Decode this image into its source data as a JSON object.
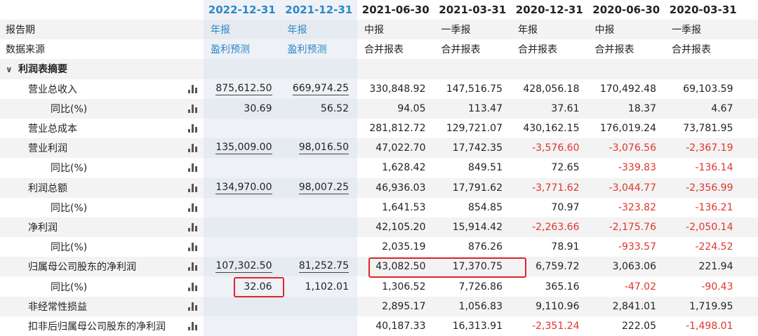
{
  "columns": [
    "2022-12-31",
    "2021-12-31",
    "2021-06-30",
    "2021-03-31",
    "2020-12-31",
    "2020-06-30",
    "2020-03-31"
  ],
  "report_period": {
    "label": "报告期",
    "values": [
      "年报",
      "年报",
      "中报",
      "一季报",
      "年报",
      "中报",
      "一季报"
    ]
  },
  "data_source": {
    "label": "数据来源",
    "values": [
      "盈利预测",
      "盈利预测",
      "合并报表",
      "合并报表",
      "合并报表",
      "合并报表",
      "合并报表"
    ]
  },
  "section": {
    "label": "利润表摘要"
  },
  "rows": [
    {
      "label": "营业总收入",
      "level": 1,
      "values": [
        "875,612.50",
        "669,974.25",
        "330,848.92",
        "147,516.75",
        "428,056.18",
        "170,492.48",
        "69,103.59"
      ]
    },
    {
      "label": "同比(%)",
      "level": 2,
      "values": [
        "30.69",
        "56.52",
        "94.05",
        "113.47",
        "37.61",
        "18.37",
        "4.67"
      ]
    },
    {
      "label": "营业总成本",
      "level": 1,
      "values": [
        "",
        "",
        "281,812.72",
        "129,721.07",
        "430,162.15",
        "176,019.24",
        "73,781.95"
      ]
    },
    {
      "label": "营业利润",
      "level": 1,
      "values": [
        "135,009.00",
        "98,016.50",
        "47,022.70",
        "17,742.35",
        "-3,576.60",
        "-3,076.56",
        "-2,367.19"
      ]
    },
    {
      "label": "同比(%)",
      "level": 2,
      "values": [
        "",
        "",
        "1,628.42",
        "849.51",
        "72.65",
        "-339.83",
        "-136.14"
      ]
    },
    {
      "label": "利润总额",
      "level": 1,
      "values": [
        "134,970.00",
        "98,007.25",
        "46,936.03",
        "17,791.62",
        "-3,771.62",
        "-3,044.77",
        "-2,356.99"
      ]
    },
    {
      "label": "同比(%)",
      "level": 2,
      "values": [
        "",
        "",
        "1,641.53",
        "854.85",
        "70.97",
        "-323.82",
        "-136.21"
      ]
    },
    {
      "label": "净利润",
      "level": 1,
      "values": [
        "",
        "",
        "42,105.20",
        "15,914.42",
        "-2,263.66",
        "-2,175.76",
        "-2,050.14"
      ]
    },
    {
      "label": "同比(%)",
      "level": 2,
      "values": [
        "",
        "",
        "2,035.19",
        "876.26",
        "78.91",
        "-933.57",
        "-224.52"
      ]
    },
    {
      "label": "归属母公司股东的净利润",
      "level": 1,
      "values": [
        "107,302.50",
        "81,252.75",
        "43,082.50",
        "17,370.75",
        "6,759.72",
        "3,063.06",
        "221.94"
      ]
    },
    {
      "label": "同比(%)",
      "level": 2,
      "values": [
        "32.06",
        "1,102.01",
        "1,306.52",
        "7,726.86",
        "365.16",
        "-47.02",
        "-90.43"
      ]
    },
    {
      "label": "非经常性损益",
      "level": 1,
      "values": [
        "",
        "",
        "2,895.17",
        "1,056.83",
        "9,110.96",
        "2,841.01",
        "1,719.95"
      ]
    },
    {
      "label": "扣非后归属母公司股东的净利润",
      "level": 1,
      "values": [
        "",
        "",
        "40,187.33",
        "16,313.91",
        "-2,351.24",
        "222.05",
        "-1,498.01"
      ]
    }
  ],
  "colors": {
    "forecast_header": "#2b87c8",
    "negative": "#e0352b",
    "highlight_box": "#e0242b",
    "alt_row": "#f3f3f3"
  },
  "icons": {
    "row_chart": "bar-chart-icon",
    "section_toggle": "chevron-down-icon"
  }
}
